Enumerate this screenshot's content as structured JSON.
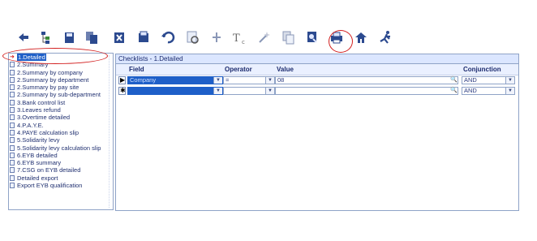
{
  "toolbar": {
    "icons": [
      "back-icon",
      "tree-icon",
      "save-icon",
      "save-all-icon",
      "delete-icon",
      "print-icon",
      "undo-icon",
      "preview-icon",
      "insert-icon",
      "calculator-icon",
      "wand-icon",
      "copy-icon",
      "search-report-icon",
      "printer-icon",
      "home-icon",
      "run-icon"
    ]
  },
  "tree": {
    "items": [
      "1.Detailed",
      "2.Summary",
      "2.Summary by company",
      "2.Summary by department",
      "2.Summary by pay site",
      "2.Summary by sub-department",
      "3.Bank control list",
      "3.Leaves refund",
      "3.Overtime detailed",
      "4.P.A.Y.E.",
      "4.PAYE calculation slip",
      "5.Solidarity levy",
      "5.Solidarity levy calculation slip",
      "6.EYB detailed",
      "6.EYB summary",
      "7.CSG on EYB detailed",
      "Detailed export",
      "Export EYB qualification"
    ],
    "selected_index": 0
  },
  "grid": {
    "title": "Checklists - 1.Detailed",
    "headers": {
      "field": "Field",
      "operator": "Operator",
      "value": "Value",
      "conjunction": "Conjunction"
    },
    "rows": [
      {
        "marker": "▶",
        "field": "Company",
        "operator": "=",
        "value": "08",
        "conjunction": "AND"
      },
      {
        "marker": "✱",
        "field": "",
        "operator": "",
        "value": "",
        "conjunction": "AND"
      }
    ]
  },
  "colors": {
    "accent": "#1e5fc8",
    "highlight": "#d21f1f"
  }
}
